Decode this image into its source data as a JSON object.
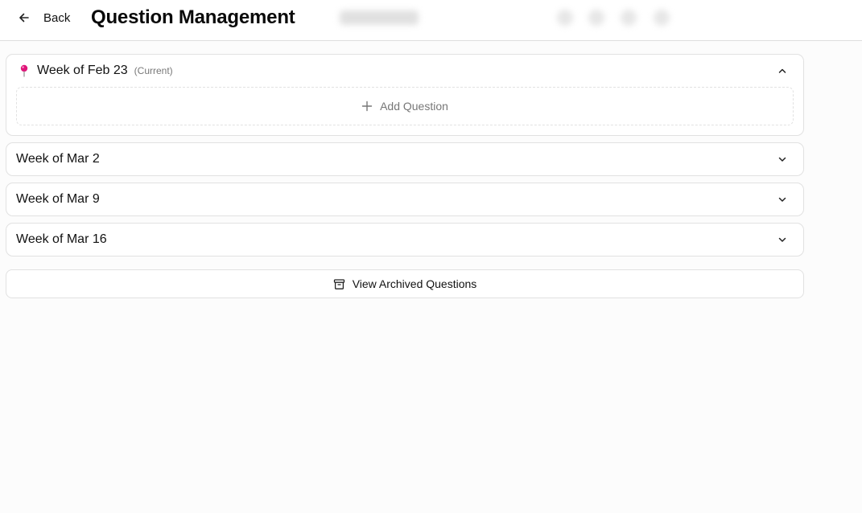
{
  "header": {
    "back_label": "Back",
    "title": "Question Management"
  },
  "weeks": [
    {
      "label": "Week of Feb 23",
      "tag": "(Current)",
      "expanded": true,
      "add_label": "Add Question"
    },
    {
      "label": "Week of Mar 2",
      "expanded": false
    },
    {
      "label": "Week of Mar 9",
      "expanded": false
    },
    {
      "label": "Week of Mar 16",
      "expanded": false
    }
  ],
  "archive": {
    "label": "View Archived Questions"
  },
  "colors": {
    "pin": "#e0157a",
    "muted": "#777777",
    "border": "#e1e1e1"
  },
  "icons": {
    "back": "arrow-left-icon",
    "pin": "pushpin-icon",
    "collapse": "chevron-up-icon",
    "expand": "chevron-down-icon",
    "add": "plus-icon",
    "archive": "archive-box-icon"
  }
}
